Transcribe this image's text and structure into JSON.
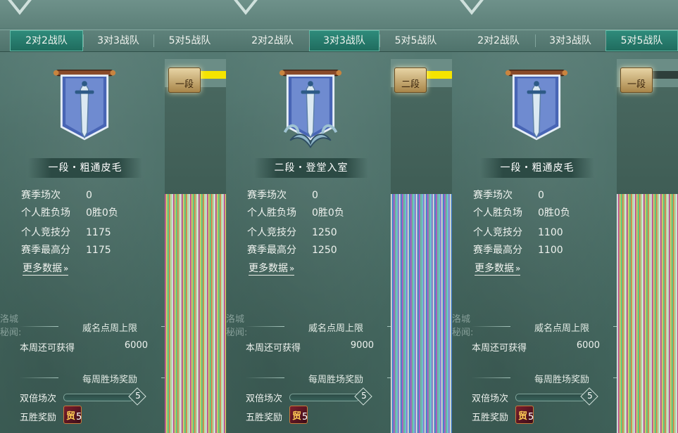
{
  "tabs": [
    "2对2战队",
    "3对3战队",
    "5对5战队"
  ],
  "labels": {
    "season_matches": "赛季场次",
    "win_loss": "个人胜负场",
    "score": "个人竞技分",
    "season_high": "赛季最高分",
    "more_data": "更多数据",
    "weekly_cap_title": "威名点周上限",
    "weekly_remaining": "本周还可获得",
    "weekly_win_title": "每周胜场奖励",
    "double_matches": "双倍场次",
    "five_win": "五胜奖励"
  },
  "bg_text": {
    "a": "洛城",
    "b": "秘闻:"
  },
  "panels": [
    {
      "active_tab": 0,
      "tier_badge": "一段",
      "rank": "一段・粗通皮毛",
      "season_matches": "0",
      "win_loss": "0胜0负",
      "score": "1175",
      "season_high": "1175",
      "weekly_remaining": "6000",
      "double_count": "5",
      "five_win_count": "5",
      "double_progress": 0.0,
      "yellow_bar": true
    },
    {
      "active_tab": 1,
      "tier_badge": "二段",
      "rank": "二段・登堂入室",
      "season_matches": "0",
      "win_loss": "0胜0负",
      "score": "1250",
      "season_high": "1250",
      "weekly_remaining": "9000",
      "double_count": "5",
      "five_win_count": "5",
      "double_progress": 0.0,
      "yellow_bar": true
    },
    {
      "active_tab": 2,
      "tier_badge": "一段",
      "rank": "一段・粗通皮毛",
      "season_matches": "0",
      "win_loss": "0胜0负",
      "score": "1100",
      "season_high": "1100",
      "weekly_remaining": "6000",
      "double_count": "5",
      "five_win_count": "5",
      "double_progress": 0.0,
      "yellow_bar": false
    }
  ],
  "colors": {
    "accent_tab": "#2a7f70",
    "yellow": "#f5e400"
  }
}
